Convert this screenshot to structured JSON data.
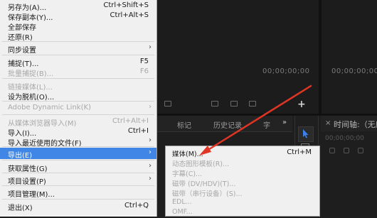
{
  "menu": {
    "items": [
      {
        "label": "另存为(A)...",
        "shortcut": "Ctrl+Shift+S"
      },
      {
        "label": "保存副本(Y)...",
        "shortcut": "Ctrl+Alt+S"
      },
      {
        "label": "全部保存",
        "shortcut": ""
      },
      {
        "label": "还原(R)",
        "shortcut": ""
      },
      {
        "label": "同步设置",
        "shortcut": ""
      },
      {
        "label": "捕捉(T)...",
        "shortcut": "F5"
      },
      {
        "label": "批量捕捉(B)...",
        "shortcut": "F6"
      },
      {
        "label": "链接媒体(L)...",
        "shortcut": ""
      },
      {
        "label": "设为脱机(O)...",
        "shortcut": ""
      },
      {
        "label": "Adobe Dynamic Link(K)",
        "shortcut": ""
      },
      {
        "label": "从媒体浏览器导入(M)",
        "shortcut": "Ctrl+Alt+I"
      },
      {
        "label": "导入(I)...",
        "shortcut": "Ctrl+I"
      },
      {
        "label": "导入最近使用的文件(F)",
        "shortcut": ""
      },
      {
        "label": "导出(E)",
        "shortcut": ""
      },
      {
        "label": "获取属性(G)",
        "shortcut": ""
      },
      {
        "label": "项目设置(P)",
        "shortcut": ""
      },
      {
        "label": "项目管理(M)...",
        "shortcut": ""
      },
      {
        "label": "退出(X)",
        "shortcut": "Ctrl+Q"
      }
    ]
  },
  "submenu": {
    "items": [
      {
        "label": "媒体(M)...",
        "shortcut": "Ctrl+M"
      },
      {
        "label": "动态图形模板(R)...",
        "shortcut": ""
      },
      {
        "label": "字幕(C)...",
        "shortcut": ""
      },
      {
        "label": "磁带 (DV/HDV)(T)...",
        "shortcut": ""
      },
      {
        "label": "磁带（串行设备）(S)...",
        "shortcut": ""
      },
      {
        "label": "EDL...",
        "shortcut": ""
      },
      {
        "label": "OMF...",
        "shortcut": ""
      }
    ]
  },
  "source_monitor": {
    "timecode": "00;00;00;00"
  },
  "program_monitor": {
    "timecode": "00;00;00;00"
  },
  "project_panel": {
    "tabs": [
      "标记",
      "历史记录",
      "字"
    ],
    "overflow_icon": "double-chevron-right"
  },
  "timeline": {
    "title": "时间轴:（无序",
    "timecode": "00;00;00;00"
  },
  "colors": {
    "highlight": "#3f86e6",
    "annotation": "#e03524",
    "panel_bg": "#1e1e1e",
    "menu_bg": "#f0f0f0"
  }
}
